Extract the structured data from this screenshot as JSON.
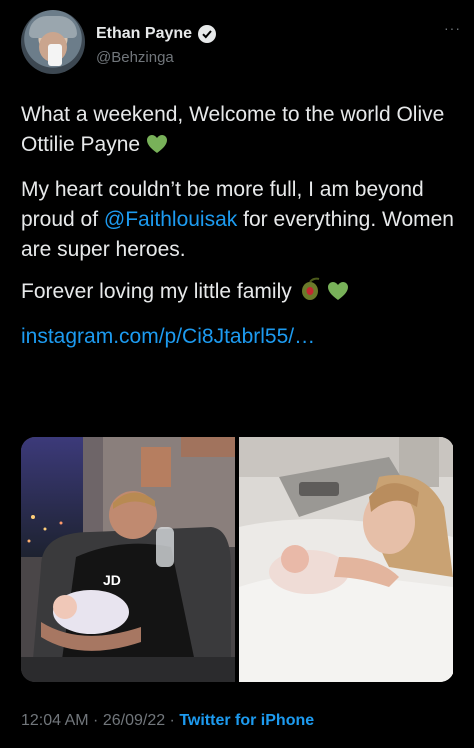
{
  "author": {
    "name": "Ethan Payne",
    "handle": "@Behzinga",
    "verified": true,
    "avatar_icon": "profile-avatar"
  },
  "more_label": "···",
  "tweet": {
    "line1": "What a weekend, Welcome to the world Olive Ottilie Payne",
    "para2_before": "My heart couldn’t be more full, I am beyond proud of ",
    "mention": "@Faithlouisak",
    "para2_after": " for everything. Women are super heroes.",
    "line3": "Forever loving my little family",
    "link": "instagram.com/p/Ci8Jtabrl55/…"
  },
  "photos": [
    {
      "icon": "photo-father-holding-newborn"
    },
    {
      "icon": "photo-mother-with-newborn"
    }
  ],
  "meta": {
    "time": "12:04 AM",
    "separator1": " · ",
    "date": "26/09/22",
    "separator2": " · ",
    "source": "Twitter for iPhone"
  },
  "colors": {
    "background": "#000000",
    "text": "#e7e9ea",
    "secondary": "#71767b",
    "link": "#1d9bf0"
  }
}
